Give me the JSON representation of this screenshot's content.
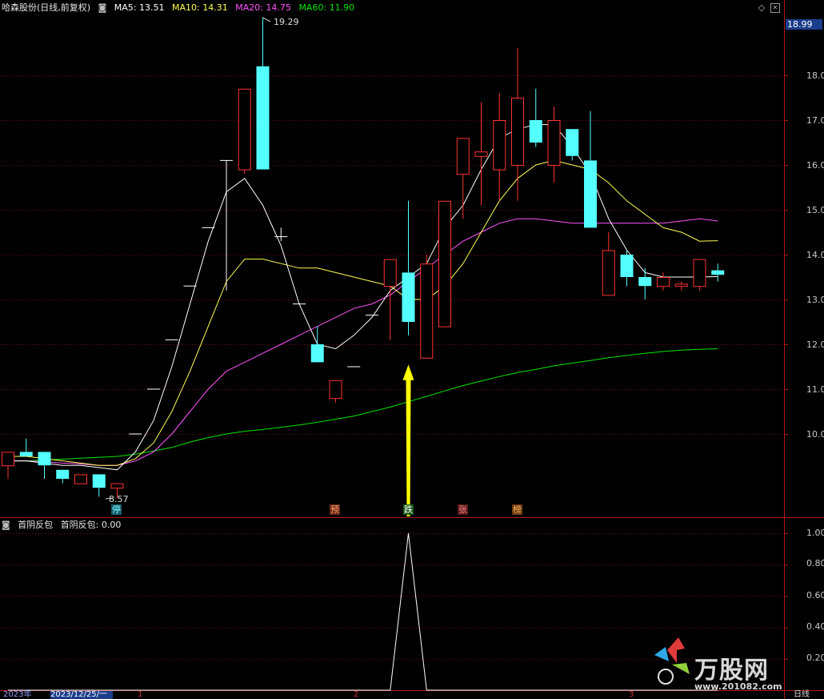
{
  "header": {
    "title": "哈森股份(日线,前复权)",
    "ma5": "MA5: 13.51",
    "ma10": "MA10: 14.31",
    "ma20": "MA20: 14.75",
    "ma60": "MA60: 11.90"
  },
  "indicator": {
    "label": "首阴反包",
    "value_label": "首阴反包: 0.00"
  },
  "current_price": "18.99",
  "high_label": "19.29",
  "low_label": "8.57",
  "events": [
    "停",
    "预",
    "跌",
    "张",
    "榜"
  ],
  "price_axis": [
    "18.00",
    "17.00",
    "16.00",
    "15.00",
    "14.00",
    "13.00",
    "12.00",
    "11.00",
    "10.00"
  ],
  "indicator_axis": [
    "1.00",
    "0.80",
    "0.60",
    "0.40",
    "0.20"
  ],
  "footer": {
    "year": "2023年",
    "date": "2023/12/25/一",
    "m1": "1",
    "m2": "2",
    "m3": "3",
    "period": "日线"
  },
  "watermark": {
    "brand": "万股网",
    "url": "www.201082.com"
  },
  "colors": {
    "up": "#ff3232",
    "down": "#54ffff",
    "ma5": "#ffffff",
    "ma10": "#ffff54",
    "ma20": "#ff54ff",
    "ma60": "#00e600",
    "arrow": "#ffff00"
  },
  "chart_data": [
    {
      "type": "candlestick",
      "ylim": [
        9.0,
        19.8
      ],
      "candles": [
        {
          "o": 9.3,
          "h": 9.6,
          "l": 9.0,
          "c": 9.6
        },
        {
          "o": 9.6,
          "h": 9.9,
          "l": 9.5,
          "c": 9.5
        },
        {
          "o": 9.6,
          "h": 9.6,
          "l": 9.0,
          "c": 9.3
        },
        {
          "o": 9.2,
          "h": 9.2,
          "l": 8.9,
          "c": 9.0
        },
        {
          "o": 8.9,
          "h": 9.1,
          "l": 8.9,
          "c": 9.1
        },
        {
          "o": 9.1,
          "h": 9.1,
          "l": 8.6,
          "c": 8.8
        },
        {
          "o": 8.8,
          "h": 8.8,
          "l": 8.57,
          "c": 8.9
        },
        {
          "o": 10.0,
          "h": 10.0,
          "l": 10.0,
          "c": 10.0
        },
        {
          "o": 11.0,
          "h": 11.0,
          "l": 11.0,
          "c": 11.0
        },
        {
          "o": 12.1,
          "h": 12.1,
          "l": 12.1,
          "c": 12.1
        },
        {
          "o": 13.3,
          "h": 13.3,
          "l": 13.3,
          "c": 13.3
        },
        {
          "o": 14.6,
          "h": 14.6,
          "l": 14.6,
          "c": 14.6
        },
        {
          "o": 16.1,
          "h": 16.1,
          "l": 13.2,
          "c": 16.1
        },
        {
          "o": 15.9,
          "h": 17.7,
          "l": 15.8,
          "c": 17.7
        },
        {
          "o": 18.2,
          "h": 19.29,
          "l": 15.9,
          "c": 15.9
        },
        {
          "o": 14.4,
          "h": 14.6,
          "l": 14.3,
          "c": 14.4
        },
        {
          "o": 12.9,
          "h": 12.9,
          "l": 12.9,
          "c": 12.9
        },
        {
          "o": 12.0,
          "h": 12.4,
          "l": 11.6,
          "c": 11.6
        },
        {
          "o": 10.8,
          "h": 11.2,
          "l": 10.7,
          "c": 11.2
        },
        {
          "o": 11.5,
          "h": 11.5,
          "l": 11.5,
          "c": 11.5
        },
        {
          "o": 12.65,
          "h": 12.65,
          "l": 12.65,
          "c": 12.65
        },
        {
          "o": 13.3,
          "h": 13.9,
          "l": 12.1,
          "c": 13.9
        },
        {
          "o": 13.6,
          "h": 15.2,
          "l": 12.2,
          "c": 12.5
        },
        {
          "o": 11.7,
          "h": 14.0,
          "l": 11.7,
          "c": 13.8
        },
        {
          "o": 12.4,
          "h": 15.2,
          "l": 12.4,
          "c": 15.2
        },
        {
          "o": 15.8,
          "h": 16.6,
          "l": 14.8,
          "c": 16.6
        },
        {
          "o": 16.2,
          "h": 17.4,
          "l": 15.1,
          "c": 16.3
        },
        {
          "o": 15.9,
          "h": 17.6,
          "l": 15.2,
          "c": 17.0
        },
        {
          "o": 16.0,
          "h": 18.6,
          "l": 15.2,
          "c": 17.5
        },
        {
          "o": 17.0,
          "h": 17.7,
          "l": 16.4,
          "c": 16.5
        },
        {
          "o": 16.0,
          "h": 17.3,
          "l": 15.6,
          "c": 17.0
        },
        {
          "o": 16.8,
          "h": 16.8,
          "l": 16.1,
          "c": 16.2
        },
        {
          "o": 16.1,
          "h": 17.2,
          "l": 14.6,
          "c": 14.6
        },
        {
          "o": 13.1,
          "h": 14.5,
          "l": 13.1,
          "c": 14.1
        },
        {
          "o": 14.0,
          "h": 14.1,
          "l": 13.3,
          "c": 13.5
        },
        {
          "o": 13.5,
          "h": 13.7,
          "l": 13.0,
          "c": 13.3
        },
        {
          "o": 13.3,
          "h": 13.6,
          "l": 13.2,
          "c": 13.5
        },
        {
          "o": 13.3,
          "h": 13.4,
          "l": 13.2,
          "c": 13.35
        },
        {
          "o": 13.3,
          "h": 13.9,
          "l": 13.2,
          "c": 13.9
        },
        {
          "o": 13.65,
          "h": 13.8,
          "l": 13.4,
          "c": 13.55
        }
      ],
      "ma5": [
        9.4,
        9.4,
        9.35,
        9.3,
        9.3,
        9.25,
        9.2,
        9.6,
        10.3,
        11.5,
        12.9,
        14.3,
        15.4,
        15.7,
        15.1,
        14.2,
        12.9,
        12.0,
        11.9,
        12.2,
        12.6,
        13.2,
        13.5,
        13.8,
        14.6,
        15.1,
        15.9,
        16.6,
        16.8,
        16.9,
        16.9,
        16.4,
        15.8,
        14.8,
        14.1,
        13.6,
        13.5,
        13.5,
        13.5,
        13.51
      ],
      "ma10": [
        9.5,
        9.5,
        9.45,
        9.4,
        9.35,
        9.3,
        9.3,
        9.45,
        9.8,
        10.5,
        11.4,
        12.4,
        13.4,
        13.9,
        13.9,
        13.8,
        13.7,
        13.7,
        13.6,
        13.5,
        13.4,
        13.3,
        13.0,
        13.0,
        13.3,
        13.8,
        14.5,
        15.2,
        15.7,
        16.0,
        16.1,
        16.0,
        15.9,
        15.6,
        15.2,
        14.9,
        14.6,
        14.5,
        14.3,
        14.31
      ],
      "ma20": [
        9.4,
        9.4,
        9.38,
        9.35,
        9.33,
        9.3,
        9.3,
        9.4,
        9.6,
        10.0,
        10.5,
        11.0,
        11.4,
        11.6,
        11.8,
        12.0,
        12.2,
        12.4,
        12.6,
        12.8,
        12.9,
        13.1,
        13.4,
        13.7,
        14.0,
        14.3,
        14.5,
        14.7,
        14.8,
        14.8,
        14.75,
        14.7,
        14.7,
        14.7,
        14.7,
        14.7,
        14.7,
        14.75,
        14.8,
        14.75
      ],
      "ma60": [
        9.4,
        9.4,
        9.42,
        9.44,
        9.46,
        9.48,
        9.5,
        9.55,
        9.62,
        9.7,
        9.82,
        9.92,
        10.0,
        10.06,
        10.1,
        10.15,
        10.2,
        10.26,
        10.33,
        10.4,
        10.5,
        10.6,
        10.72,
        10.84,
        10.96,
        11.08,
        11.18,
        11.28,
        11.37,
        11.44,
        11.52,
        11.58,
        11.64,
        11.7,
        11.75,
        11.8,
        11.84,
        11.87,
        11.89,
        11.9
      ]
    },
    {
      "type": "line",
      "name": "首阴反包",
      "ylim": [
        0,
        1.05
      ],
      "signal_index": 22,
      "values": [
        0,
        0,
        0,
        0,
        0,
        0,
        0,
        0,
        0,
        0,
        0,
        0,
        0,
        0,
        0,
        0,
        0,
        0,
        0,
        0,
        0,
        0,
        1,
        0,
        0,
        0,
        0,
        0,
        0,
        0,
        0,
        0,
        0,
        0,
        0,
        0,
        0,
        0,
        0,
        0
      ]
    }
  ]
}
